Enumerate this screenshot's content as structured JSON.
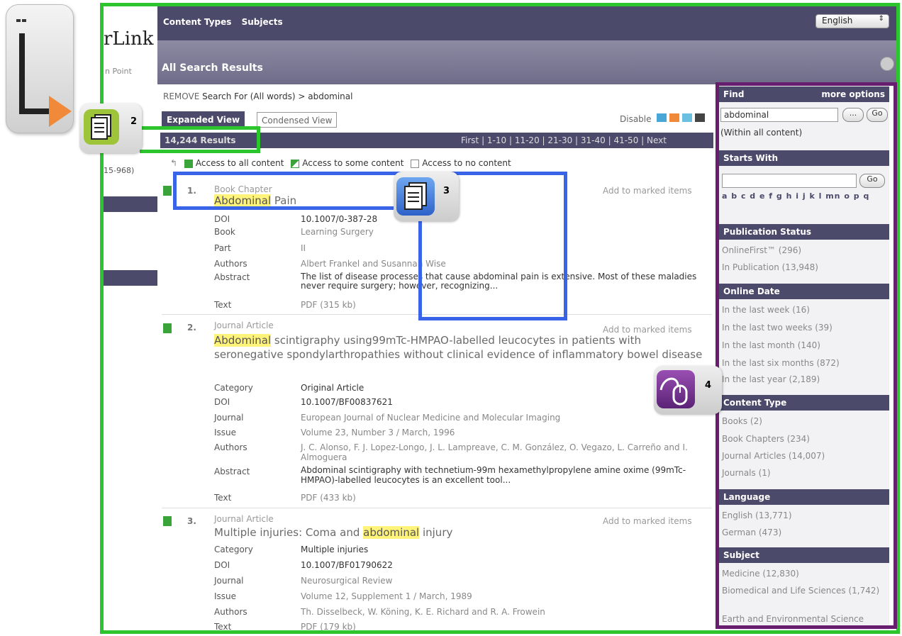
{
  "brand": {
    "title": "rLink",
    "subtitle": "n Point"
  },
  "left": {
    "range_text": "15-968)"
  },
  "topbar": {
    "links": [
      "Content Types",
      "Subjects"
    ],
    "language": "English"
  },
  "header": {
    "title": "All Search Results"
  },
  "breadcrumb": {
    "remove": "REMOVE",
    "text": "Search For (All words) > abdominal"
  },
  "tabs": {
    "expanded": "Expanded View",
    "condensed": "Condensed View"
  },
  "disable_label": "Disable",
  "results": {
    "count": "14,244 Results",
    "pager": "First | 1-10 | 11-20 | 21-30 | 31-40 | 41-50 | Next"
  },
  "legend": {
    "all": "Access to all content",
    "some": "Access to some content",
    "none": "Access to no content"
  },
  "items": [
    {
      "num": "1.",
      "type": "Book Chapter",
      "title_hl": "Abdominal",
      "title_rest": "Pain",
      "add": "Add to marked items",
      "rows": [
        [
          "DOI",
          "10.1007/0-387-28"
        ],
        [
          "Book",
          "Learning Surgery"
        ],
        [
          "Part",
          "II"
        ],
        [
          "Authors",
          "Albert Frankel and Susannah Wise"
        ],
        [
          "Abstract",
          "The list of disease processes that cause abdominal pain is extensive. Most of these maladies never require surgery; however, recognizing..."
        ],
        [
          "Text",
          "PDF (315 kb)"
        ]
      ]
    },
    {
      "num": "2.",
      "type": "Journal Article",
      "title_hl": "Abdominal",
      "title_rest": "scintigraphy using99mTc-HMPAO-labelled leucocytes in patients with seronegative spondylarthropathies without clinical evidence of inflammatory bowel disease",
      "add": "Add to marked items",
      "rows": [
        [
          "Category",
          "Original Article"
        ],
        [
          "DOI",
          "10.1007/BF00837621"
        ],
        [
          "Journal",
          "European Journal of Nuclear Medicine and Molecular Imaging"
        ],
        [
          "Issue",
          "Volume 23, Number 3 / March, 1996"
        ],
        [
          "Authors",
          "J. C. Alonso, F. J. Lopez-Longo, J. L. Lampreave, C. M. González, O. Vegazo, L. Carreño and I. Almoguera"
        ],
        [
          "Abstract",
          "Abdominal scintigraphy with technetium-99m hexamethylpropylene amine oxime (99mTc-HMPAO)-labelled leucocytes is an excellent tool..."
        ],
        [
          "Text",
          "PDF (433 kb)"
        ]
      ]
    },
    {
      "num": "3.",
      "type": "Journal Article",
      "title_pre": "Multiple injuries: Coma and",
      "title_hl": "abdominal",
      "title_rest": "injury",
      "add": "Add to marked items",
      "rows": [
        [
          "Category",
          "Multiple injuries"
        ],
        [
          "DOI",
          "10.1007/BF01790622"
        ],
        [
          "Journal",
          "Neurosurgical Review"
        ],
        [
          "Issue",
          "Volume 12, Supplement 1 / March, 1989"
        ],
        [
          "Authors",
          "Th. Disselbeck, W. Köning, K. E. Richard and R. A. Frowein"
        ],
        [
          "Text",
          "PDF (179 kb)"
        ]
      ]
    }
  ],
  "sidebar": {
    "find": "Find",
    "more_options": "more options",
    "find_value": "abdominal",
    "find_btn_dots": "...",
    "go": "Go",
    "within": "(Within all content)",
    "starts_with": "Starts With",
    "alphabet": "a b c d e f g h i j k l mn o p q",
    "sections": [
      {
        "title": "Publication Status",
        "links": [
          "OnlineFirst™ (296)",
          "In Publication (13,948)"
        ]
      },
      {
        "title": "Online Date",
        "links": [
          "In the last week (16)",
          "In the last two weeks (39)",
          "In the last month (140)",
          "In the last six months (872)",
          "In the last year (2,189)"
        ]
      },
      {
        "title": "Content Type",
        "links": [
          "Books (2)",
          "Book Chapters (234)",
          "Journal Articles (14,007)",
          "Journals (1)"
        ]
      },
      {
        "title": "Language",
        "links": [
          "English (13,771)",
          "German (473)"
        ]
      },
      {
        "title": "Subject",
        "links": [
          "Medicine (12,830)",
          "Biomedical and Life Sciences (1,742)",
          "Earth and Environmental Science"
        ]
      }
    ]
  },
  "badges": {
    "b2": "2",
    "b3": "3",
    "b4": "4"
  },
  "colors": {
    "green": "#2dc52d",
    "purple": "#681e6e",
    "blue": "#3a64e8",
    "nav": "#4c4a6a",
    "highlight": "#fff37a"
  }
}
